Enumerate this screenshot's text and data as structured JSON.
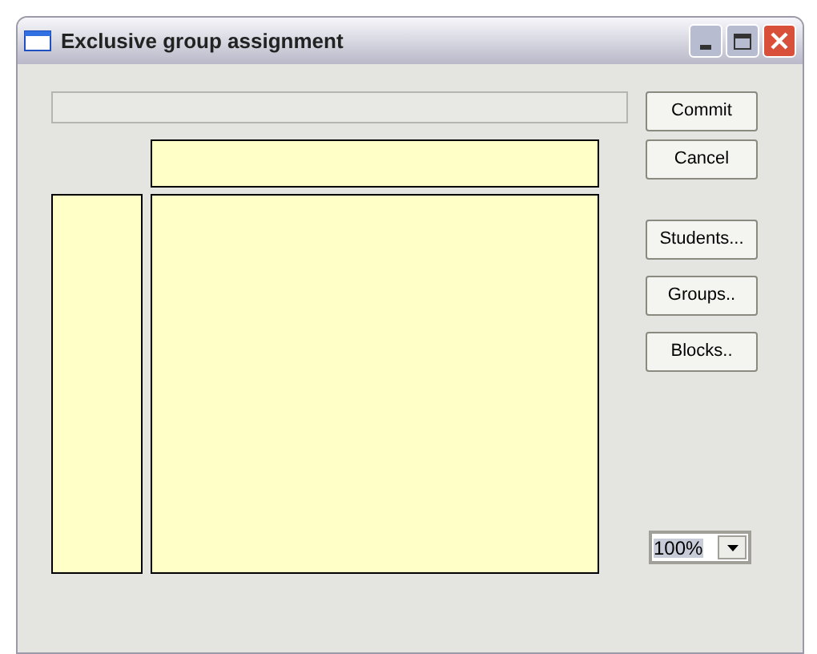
{
  "window": {
    "title": "Exclusive group assignment"
  },
  "dialog_buttons": [
    {
      "label": "Commit"
    },
    {
      "label": "Cancel"
    }
  ],
  "tool_buttons": [
    {
      "label": "Students..."
    },
    {
      "label": "Groups.."
    },
    {
      "label": "Blocks.."
    }
  ],
  "zoom": {
    "value": "100%"
  }
}
